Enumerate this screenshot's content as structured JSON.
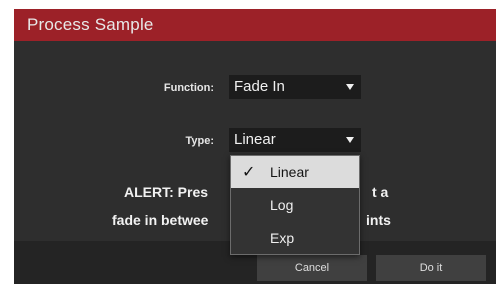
{
  "dialog": {
    "title": "Process Sample",
    "colors": {
      "title_bar": "#9c2128",
      "background": "#2e2e2e",
      "footer": "#242424",
      "select_bg": "#1c1c1c",
      "selected_item": "#dcdcdc"
    }
  },
  "form": {
    "function_label": "Function:",
    "function_value": "Fade In",
    "type_label": "Type:",
    "type_value": "Linear"
  },
  "alert": {
    "line1_left": "ALERT: Pres",
    "line1_right": "t a",
    "line2_left": "fade in betwee",
    "line2_right": "ints"
  },
  "type_dropdown": {
    "check_icon": "check-icon",
    "options": [
      {
        "label": "Linear",
        "selected": true
      },
      {
        "label": "Log",
        "selected": false
      },
      {
        "label": "Exp",
        "selected": false
      }
    ]
  },
  "buttons": {
    "cancel": "Cancel",
    "do_it": "Do it"
  }
}
